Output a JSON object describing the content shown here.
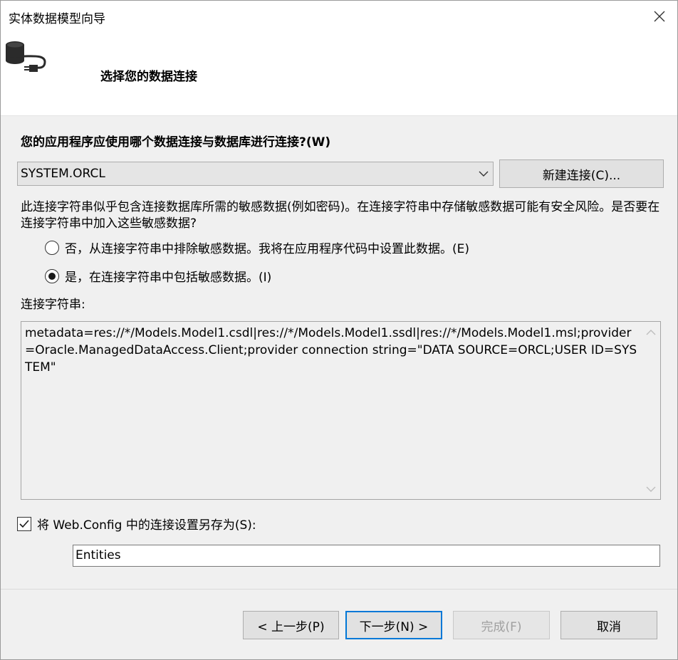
{
  "window": {
    "title": "实体数据模型向导",
    "close_icon": "close-icon"
  },
  "header": {
    "icon": "database-plug-icon",
    "title": "选择您的数据连接"
  },
  "question": "您的应用程序应使用哪个数据连接与数据库进行连接?(W)",
  "connection": {
    "selected": "SYSTEM.ORCL",
    "new_button": "新建连接(C)..."
  },
  "warning": "此连接字符串似乎包含连接数据库所需的敏感数据(例如密码)。在连接字符串中存储敏感数据可能有安全风险。是否要在连接字符串中加入这些敏感数据?",
  "options": {
    "exclude_label": "否，从连接字符串中排除敏感数据。我将在应用程序代码中设置此数据。(E)",
    "exclude_checked": false,
    "include_label": "是，在连接字符串中包括敏感数据。(I)",
    "include_checked": true
  },
  "connection_string": {
    "label": "连接字符串:",
    "value": "metadata=res://*/Models.Model1.csdl|res://*/Models.Model1.ssdl|res://*/Models.Model1.msl;provider=Oracle.ManagedDataAccess.Client;provider connection string=\"DATA SOURCE=ORCL;USER ID=SYSTEM\""
  },
  "save": {
    "label": "将 Web.Config 中的连接设置另存为(S):",
    "checked": true,
    "value": "Entities"
  },
  "footer": {
    "prev": "< 上一步(P)",
    "next": "下一步(N) >",
    "finish": "完成(F)",
    "cancel": "取消"
  }
}
